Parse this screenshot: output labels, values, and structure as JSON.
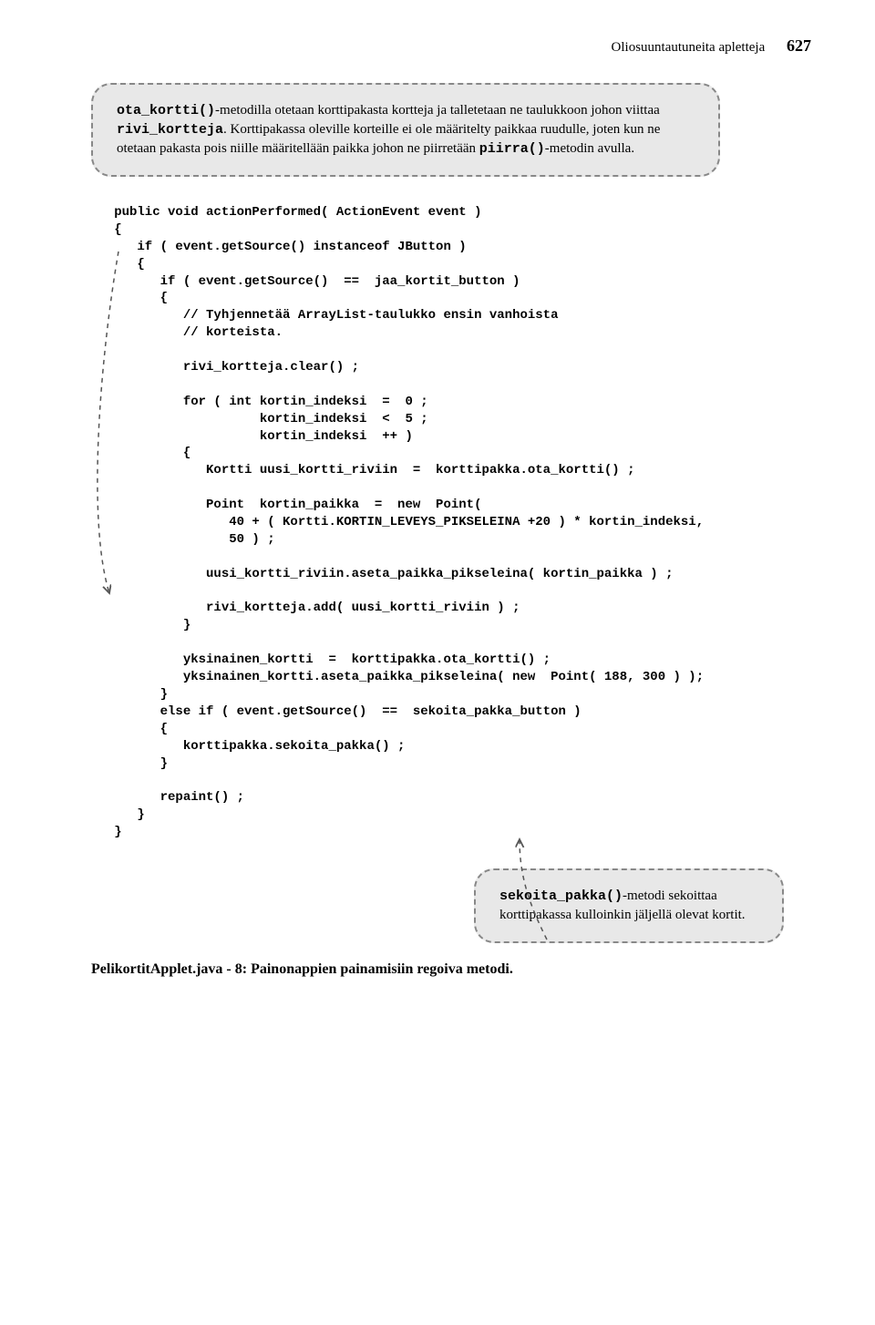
{
  "header": {
    "title": "Oliosuuntautuneita apletteja",
    "pagenum": "627"
  },
  "callout1": {
    "p1a": "ota_kortti()",
    "p1b": "-metodilla otetaan korttipakasta kortteja ja talletetaan ne taulukkoon johon viittaa ",
    "p1c": "rivi_kortteja",
    "p1d": ". Korttipakassa oleville korteille ei ole määritelty paikkaa ruudulle, joten kun ne otetaan pakasta pois niille määritellään paikka johon ne piirretään ",
    "p1e": "piirra()",
    "p1f": "-metodin avulla."
  },
  "code": {
    "l01": "   public void actionPerformed( ActionEvent event )",
    "l02": "   {",
    "l03": "      if ( event.getSource() instanceof JButton )",
    "l04": "      {",
    "l05": "         if ( event.getSource()  ==  jaa_kortit_button )",
    "l06": "         {",
    "l07": "            // Tyhjennetää ArrayList-taulukko ensin vanhoista",
    "l08": "            // korteista.",
    "l09": "",
    "l10": "            rivi_kortteja.clear() ;",
    "l11": "",
    "l12": "            for ( int kortin_indeksi  =  0 ;",
    "l13": "                      kortin_indeksi  <  5 ;",
    "l14": "                      kortin_indeksi  ++ )",
    "l15": "            {",
    "l16": "               Kortti uusi_kortti_riviin  =  korttipakka.ota_kortti() ;",
    "l17": "",
    "l18": "               Point  kortin_paikka  =  new  Point(",
    "l19": "                  40 + ( Kortti.KORTIN_LEVEYS_PIKSELEINA +20 ) * kortin_indeksi,",
    "l20": "                  50 ) ;",
    "l21": "",
    "l22": "               uusi_kortti_riviin.aseta_paikka_pikseleina( kortin_paikka ) ;",
    "l23": "",
    "l24": "               rivi_kortteja.add( uusi_kortti_riviin ) ;",
    "l25": "            }",
    "l26": "",
    "l27": "            yksinainen_kortti  =  korttipakka.ota_kortti() ;",
    "l28": "            yksinainen_kortti.aseta_paikka_pikseleina( new  Point( 188, 300 ) );",
    "l29": "         }",
    "l30": "         else if ( event.getSource()  ==  sekoita_pakka_button )",
    "l31": "         {",
    "l32": "            korttipakka.sekoita_pakka() ;",
    "l33": "         }",
    "l34": "",
    "l35": "         repaint() ;",
    "l36": "      }",
    "l37": "   }"
  },
  "callout2": {
    "p1a": "sekoita_pakka()",
    "p1b": "-metodi sekoittaa korttipakassa kulloinkin jäljellä olevat kortit."
  },
  "caption": "PelikortitApplet.java - 8:  Painonappien painamisiin regoiva metodi."
}
